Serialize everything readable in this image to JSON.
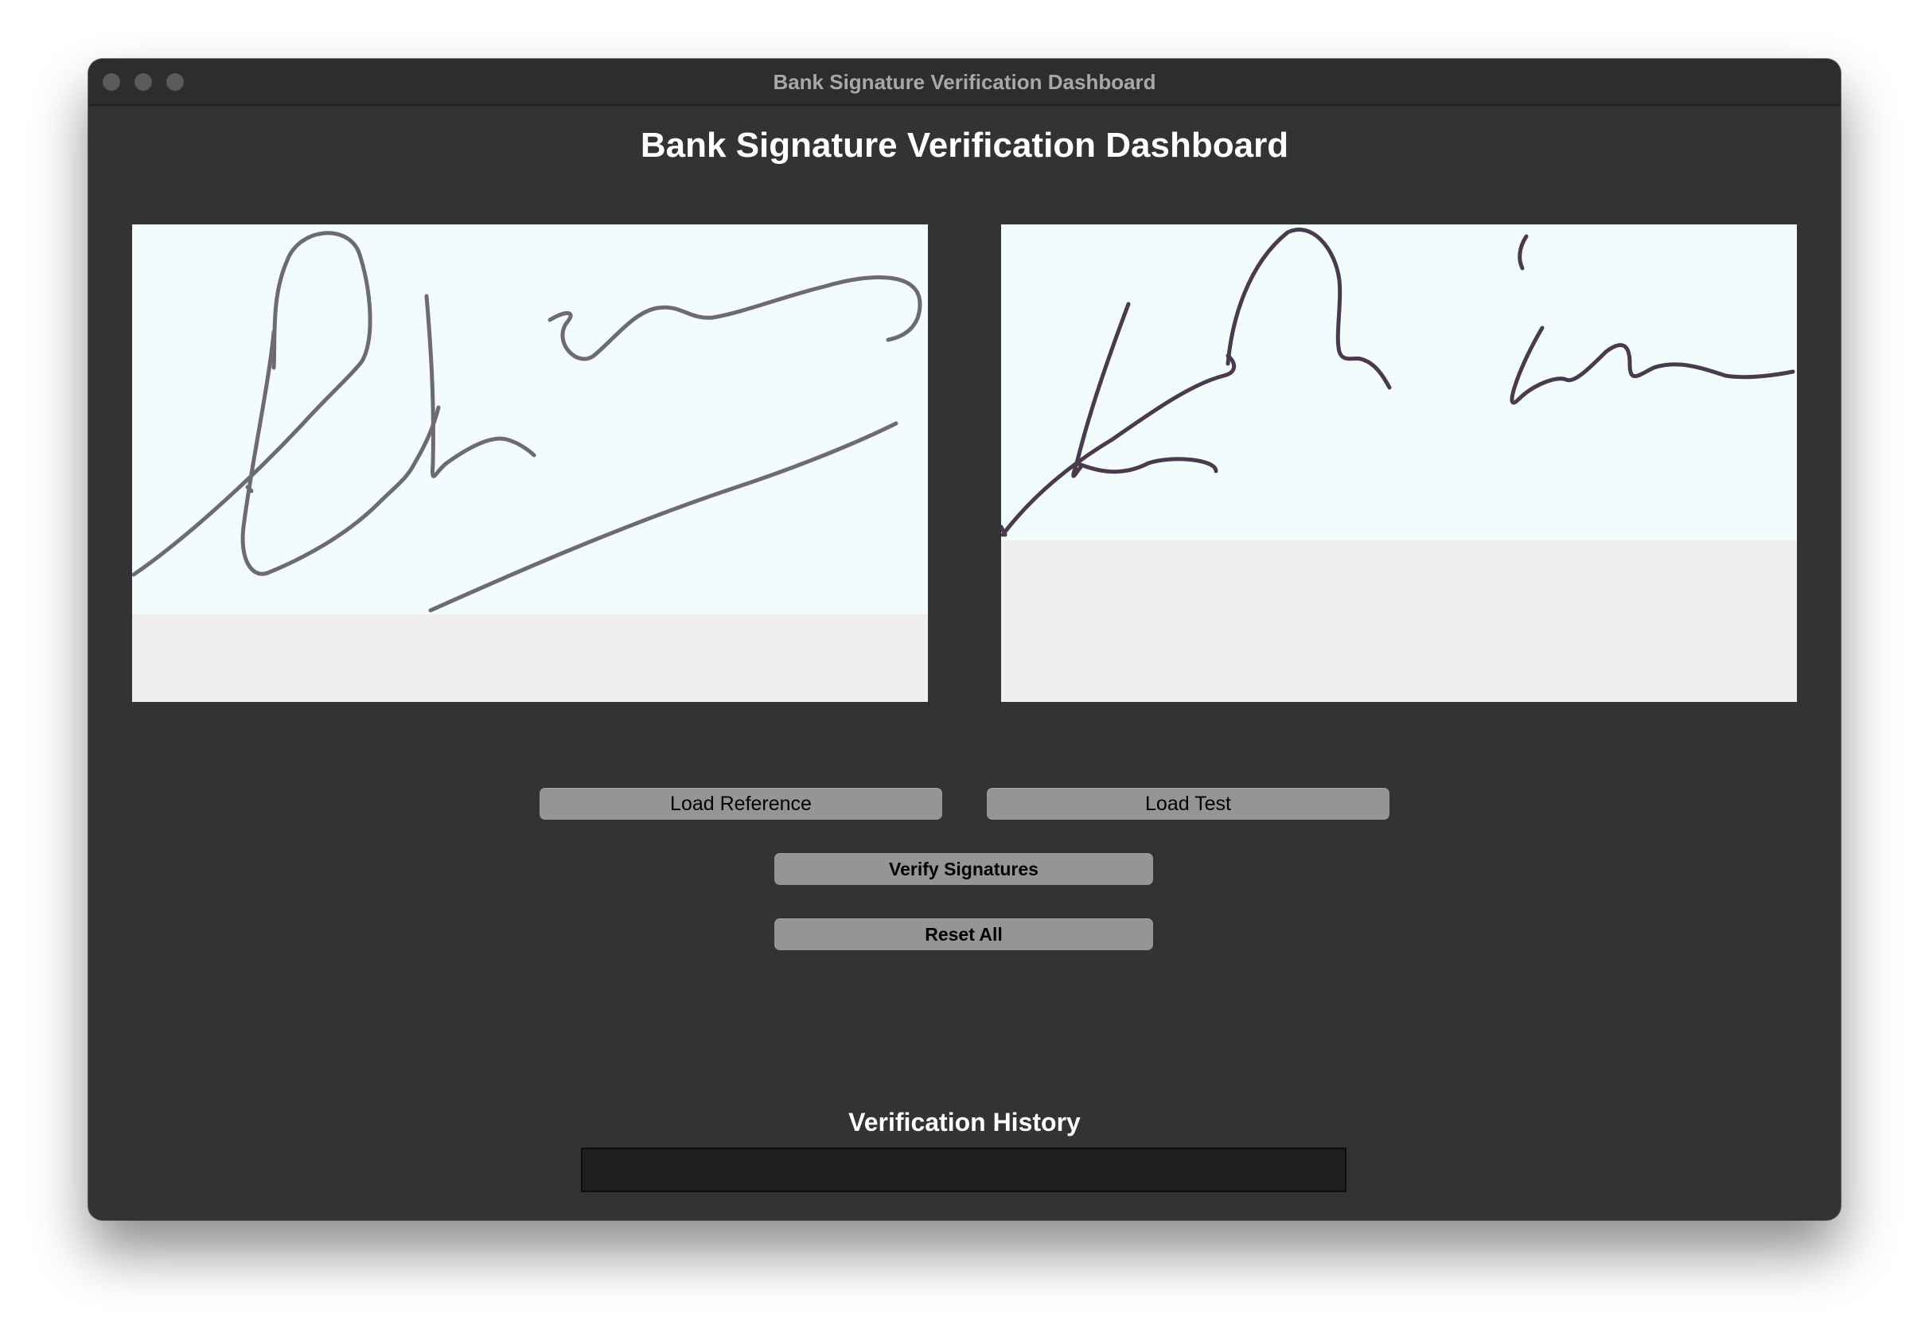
{
  "window": {
    "title": "Bank Signature Verification Dashboard"
  },
  "main": {
    "heading": "Bank Signature Verification Dashboard"
  },
  "panels": {
    "reference": {
      "image": "reference-signature"
    },
    "test": {
      "image": "test-signature"
    }
  },
  "buttons": {
    "load_reference": "Load Reference",
    "load_test": "Load Test",
    "verify": "Verify Signatures",
    "reset": "Reset All"
  },
  "history": {
    "heading": "Verification History",
    "entries": []
  },
  "colors": {
    "window_bg": "#333333",
    "button_bg": "#959595",
    "signature_bg": "#f3fcfc",
    "panel_bg": "#efefef",
    "history_bg": "#1f1f1f"
  }
}
